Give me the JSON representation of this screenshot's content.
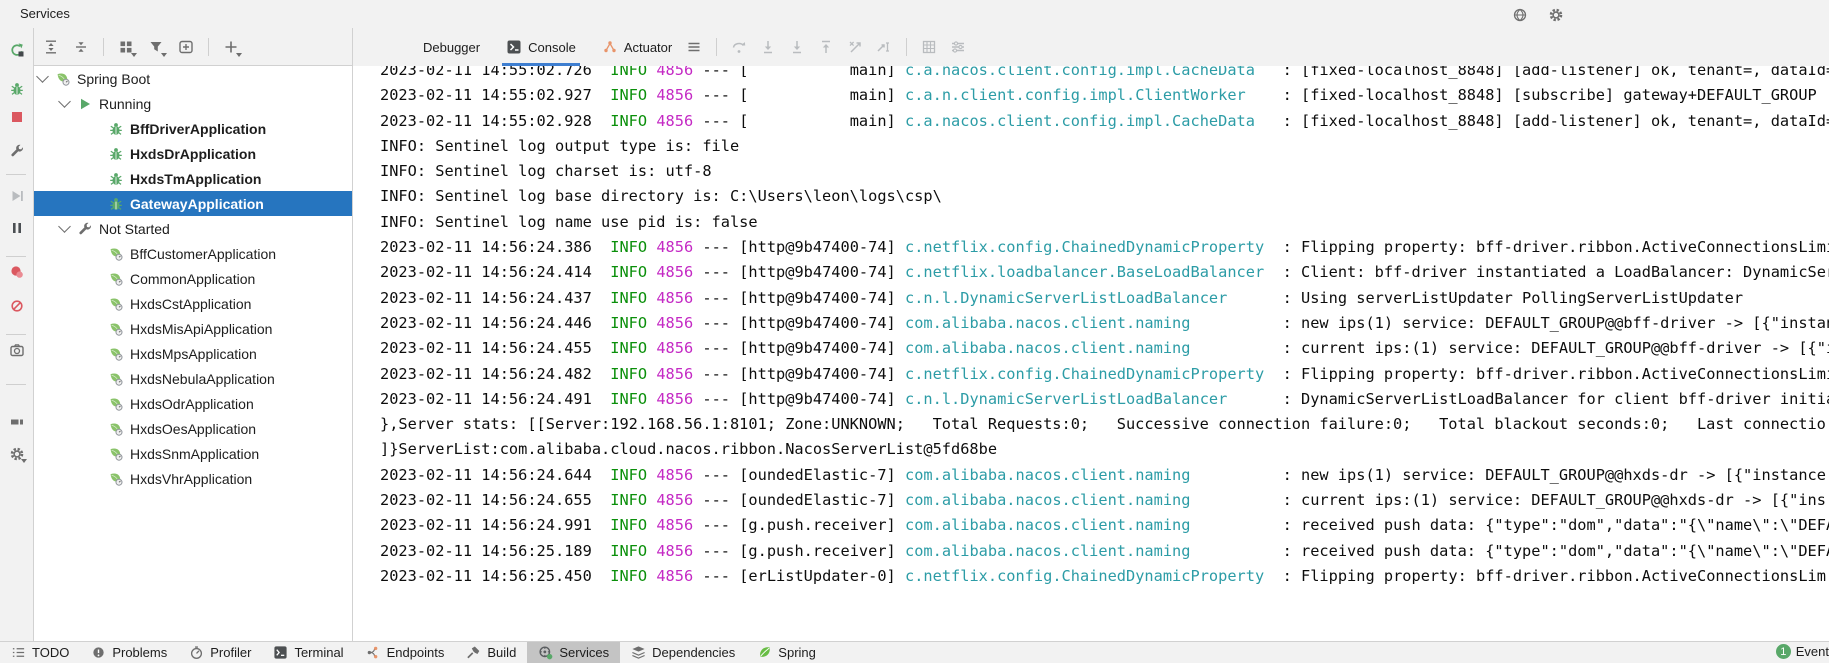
{
  "window": {
    "title": "Services"
  },
  "colors": {
    "selection_blue": "#2675bf",
    "tab_underline_blue": "#3e7ed0",
    "info_green": "#0a8f0a",
    "pid_magenta": "#c429c4",
    "logger_teal": "#2c9ca6",
    "icon_green": "#59a869",
    "icon_red": "#db5860",
    "spring_green": "#68bd45",
    "selected_tab_gray": "#c4c4c4"
  },
  "titlebar_icons": [
    {
      "icon": "globe",
      "name": "globe-icon"
    },
    {
      "icon": "gear",
      "name": "settings-gear-icon"
    }
  ],
  "left_strip": [
    {
      "icon": "rerun",
      "name": "rerun-button"
    },
    {
      "icon": "bug",
      "name": "rerun-debug-button"
    },
    {
      "icon": "stop",
      "name": "stop-button"
    },
    {
      "icon": "wrench",
      "name": "edit-configuration-button"
    },
    {
      "sep": true
    },
    {
      "icon": "resume",
      "name": "resume-button"
    },
    {
      "icon": "pause",
      "name": "pause-button"
    },
    {
      "sep": true
    },
    {
      "icon": "bp",
      "name": "view-breakpoints-button"
    },
    {
      "icon": "mute",
      "name": "mute-breakpoints-button"
    },
    {
      "sep": true
    },
    {
      "icon": "camera",
      "name": "thread-dump-button"
    },
    {
      "sep": true
    },
    {
      "icon": "layout",
      "name": "restore-layout-button"
    },
    {
      "icon": "gear",
      "name": "settings-button",
      "dd": true
    }
  ],
  "tree_toolbar": [
    {
      "icon": "expand",
      "name": "expand-all-button"
    },
    {
      "icon": "collapse",
      "name": "collapse-all-button"
    },
    {
      "sep": true
    },
    {
      "icon": "group",
      "name": "group-by-button",
      "dd": true
    },
    {
      "icon": "filter",
      "name": "filter-button",
      "dd": true
    },
    {
      "icon": "addbox",
      "name": "add-service-button"
    },
    {
      "sep": true
    },
    {
      "icon": "plus",
      "name": "add-button",
      "dd": true
    }
  ],
  "tree": {
    "rows": [
      {
        "level": 0,
        "chevron": true,
        "icon": "boot",
        "label": "Spring Boot"
      },
      {
        "level": 1,
        "chevron": true,
        "icon": "play",
        "label": "Running"
      },
      {
        "level": 2,
        "chevron": false,
        "icon": "bug",
        "label": "BffDriverApplication",
        "bold": true
      },
      {
        "level": 2,
        "chevron": false,
        "icon": "bug",
        "label": "HxdsDrApplication",
        "bold": true
      },
      {
        "level": 2,
        "chevron": false,
        "icon": "bug",
        "label": "HxdsTmApplication",
        "bold": true
      },
      {
        "level": 2,
        "chevron": false,
        "icon": "bug",
        "label": "GatewayApplication",
        "bold": true,
        "selected": true
      },
      {
        "level": 1,
        "chevron": true,
        "icon": "wrench",
        "label": "Not Started"
      },
      {
        "level": 2,
        "chevron": false,
        "icon": "boot",
        "label": "BffCustomerApplication"
      },
      {
        "level": 2,
        "chevron": false,
        "icon": "boot",
        "label": "CommonApplication"
      },
      {
        "level": 2,
        "chevron": false,
        "icon": "boot",
        "label": "HxdsCstApplication"
      },
      {
        "level": 2,
        "chevron": false,
        "icon": "boot",
        "label": "HxdsMisApiApplication"
      },
      {
        "level": 2,
        "chevron": false,
        "icon": "boot",
        "label": "HxdsMpsApplication"
      },
      {
        "level": 2,
        "chevron": false,
        "icon": "boot",
        "label": "HxdsNebulaApplication"
      },
      {
        "level": 2,
        "chevron": false,
        "icon": "boot",
        "label": "HxdsOdrApplication"
      },
      {
        "level": 2,
        "chevron": false,
        "icon": "boot",
        "label": "HxdsOesApplication"
      },
      {
        "level": 2,
        "chevron": false,
        "icon": "boot",
        "label": "HxdsSnmApplication"
      },
      {
        "level": 2,
        "chevron": false,
        "icon": "boot",
        "label": "HxdsVhrApplication"
      }
    ]
  },
  "console": {
    "tabs": [
      {
        "label": "Debugger",
        "name": "tab-debugger"
      },
      {
        "label": "Console",
        "name": "tab-console",
        "icon": "consoleTab",
        "selected": true
      },
      {
        "label": "Actuator",
        "name": "tab-actuator",
        "icon": "actuator"
      }
    ],
    "toolbar": [
      {
        "icon": "menu",
        "name": "console-menu-button"
      },
      {
        "sep": true
      },
      {
        "icon": "stepover",
        "name": "step-over-button"
      },
      {
        "icon": "downbar",
        "name": "step-into-button"
      },
      {
        "icon": "downbar",
        "name": "force-step-into-button"
      },
      {
        "icon": "upbar",
        "name": "step-out-button"
      },
      {
        "icon": "xarrow",
        "name": "drop-frame-button"
      },
      {
        "icon": "xcursor",
        "name": "run-to-cursor-button"
      },
      {
        "sep": true
      },
      {
        "icon": "grid",
        "name": "evaluate-expression-button"
      },
      {
        "icon": "sliders",
        "name": "layout-settings-button"
      }
    ],
    "format": {
      "level": "INFO",
      "pid": "4856",
      "separator": "---"
    },
    "lines": [
      {
        "time": "2023-02-11 14:55:02.726",
        "thread": "           main",
        "logger": "c.a.nacos.client.config.impl.CacheData",
        "msg": "[fixed-localhost_8848] [add-listener] ok, tenant=, dataId="
      },
      {
        "time": "2023-02-11 14:55:02.927",
        "thread": "           main",
        "logger": "c.a.n.client.config.impl.ClientWorker",
        "msg": "[fixed-localhost_8848] [subscribe] gateway+DEFAULT_GROUP"
      },
      {
        "time": "2023-02-11 14:55:02.928",
        "thread": "           main",
        "logger": "c.a.nacos.client.config.impl.CacheData",
        "msg": "[fixed-localhost_8848] [add-listener] ok, tenant=, dataId="
      },
      {
        "raw": "INFO: Sentinel log output type is: file"
      },
      {
        "raw": "INFO: Sentinel log charset is: utf-8"
      },
      {
        "raw": "INFO: Sentinel log base directory is: C:\\Users\\leon\\logs\\csp\\"
      },
      {
        "raw": "INFO: Sentinel log name use pid is: false"
      },
      {
        "time": "2023-02-11 14:56:24.386",
        "thread": "http@9b47400-74",
        "logger": "c.netflix.config.ChainedDynamicProperty",
        "msg": "Flipping property: bff-driver.ribbon.ActiveConnectionsLimi"
      },
      {
        "time": "2023-02-11 14:56:24.414",
        "thread": "http@9b47400-74",
        "logger": "c.netflix.loadbalancer.BaseLoadBalancer",
        "msg": "Client: bff-driver instantiated a LoadBalancer: DynamicSer"
      },
      {
        "time": "2023-02-11 14:56:24.437",
        "thread": "http@9b47400-74",
        "logger": "c.n.l.DynamicServerListLoadBalancer",
        "msg": "Using serverListUpdater PollingServerListUpdater"
      },
      {
        "time": "2023-02-11 14:56:24.446",
        "thread": "http@9b47400-74",
        "logger": "com.alibaba.nacos.client.naming",
        "msg": "new ips(1) service: DEFAULT_GROUP@@bff-driver -> [{\"instan"
      },
      {
        "time": "2023-02-11 14:56:24.455",
        "thread": "http@9b47400-74",
        "logger": "com.alibaba.nacos.client.naming",
        "msg": "current ips:(1) service: DEFAULT_GROUP@@bff-driver -> [{\"i"
      },
      {
        "time": "2023-02-11 14:56:24.482",
        "thread": "http@9b47400-74",
        "logger": "c.netflix.config.ChainedDynamicProperty",
        "msg": "Flipping property: bff-driver.ribbon.ActiveConnectionsLimi"
      },
      {
        "time": "2023-02-11 14:56:24.491",
        "thread": "http@9b47400-74",
        "logger": "c.n.l.DynamicServerListLoadBalancer",
        "msg": "DynamicServerListLoadBalancer for client bff-driver initia"
      },
      {
        "raw": "},Server stats: [[Server:192.168.56.1:8101; Zone:UNKNOWN;   Total Requests:0;   Successive connection failure:0;   Total blackout seconds:0;   Last connectio"
      },
      {
        "raw": "]}ServerList:com.alibaba.cloud.nacos.ribbon.NacosServerList@5fd68be"
      },
      {
        "time": "2023-02-11 14:56:24.644",
        "thread": "oundedElastic-7",
        "logger": "com.alibaba.nacos.client.naming",
        "msg": "new ips(1) service: DEFAULT_GROUP@@hxds-dr -> [{\"instance"
      },
      {
        "time": "2023-02-11 14:56:24.655",
        "thread": "oundedElastic-7",
        "logger": "com.alibaba.nacos.client.naming",
        "msg": "current ips:(1) service: DEFAULT_GROUP@@hxds-dr -> [{\"ins"
      },
      {
        "time": "2023-02-11 14:56:24.991",
        "thread": "g.push.receiver",
        "logger": "com.alibaba.nacos.client.naming",
        "msg": "received push data: {\"type\":\"dom\",\"data\":\"{\\\"name\\\":\\\"DEFA"
      },
      {
        "time": "2023-02-11 14:56:25.189",
        "thread": "g.push.receiver",
        "logger": "com.alibaba.nacos.client.naming",
        "msg": "received push data: {\"type\":\"dom\",\"data\":\"{\\\"name\\\":\\\"DEFA"
      },
      {
        "time": "2023-02-11 14:56:25.450",
        "thread": "erListUpdater-0",
        "logger": "c.netflix.config.ChainedDynamicProperty",
        "msg": "Flipping property: bff-driver.ribbon.ActiveConnectionsLim"
      }
    ]
  },
  "statusbar": {
    "tabs": [
      {
        "label": "TODO",
        "icon": "todo",
        "name": "toolwindow-tab-todo"
      },
      {
        "label": "Problems",
        "icon": "problems",
        "name": "toolwindow-tab-problems"
      },
      {
        "label": "Profiler",
        "icon": "profiler",
        "name": "toolwindow-tab-profiler"
      },
      {
        "label": "Terminal",
        "icon": "terminal",
        "name": "toolwindow-tab-terminal"
      },
      {
        "label": "Endpoints",
        "icon": "endpoints",
        "name": "toolwindow-tab-endpoints"
      },
      {
        "label": "Build",
        "icon": "build",
        "name": "toolwindow-tab-build"
      },
      {
        "label": "Services",
        "icon": "services",
        "name": "toolwindow-tab-services",
        "selected": true
      },
      {
        "label": "Dependencies",
        "icon": "deps",
        "name": "toolwindow-tab-dependencies"
      },
      {
        "label": "Spring",
        "icon": "spring",
        "name": "toolwindow-tab-spring"
      }
    ],
    "event": {
      "count": "1",
      "label": "Event"
    }
  }
}
